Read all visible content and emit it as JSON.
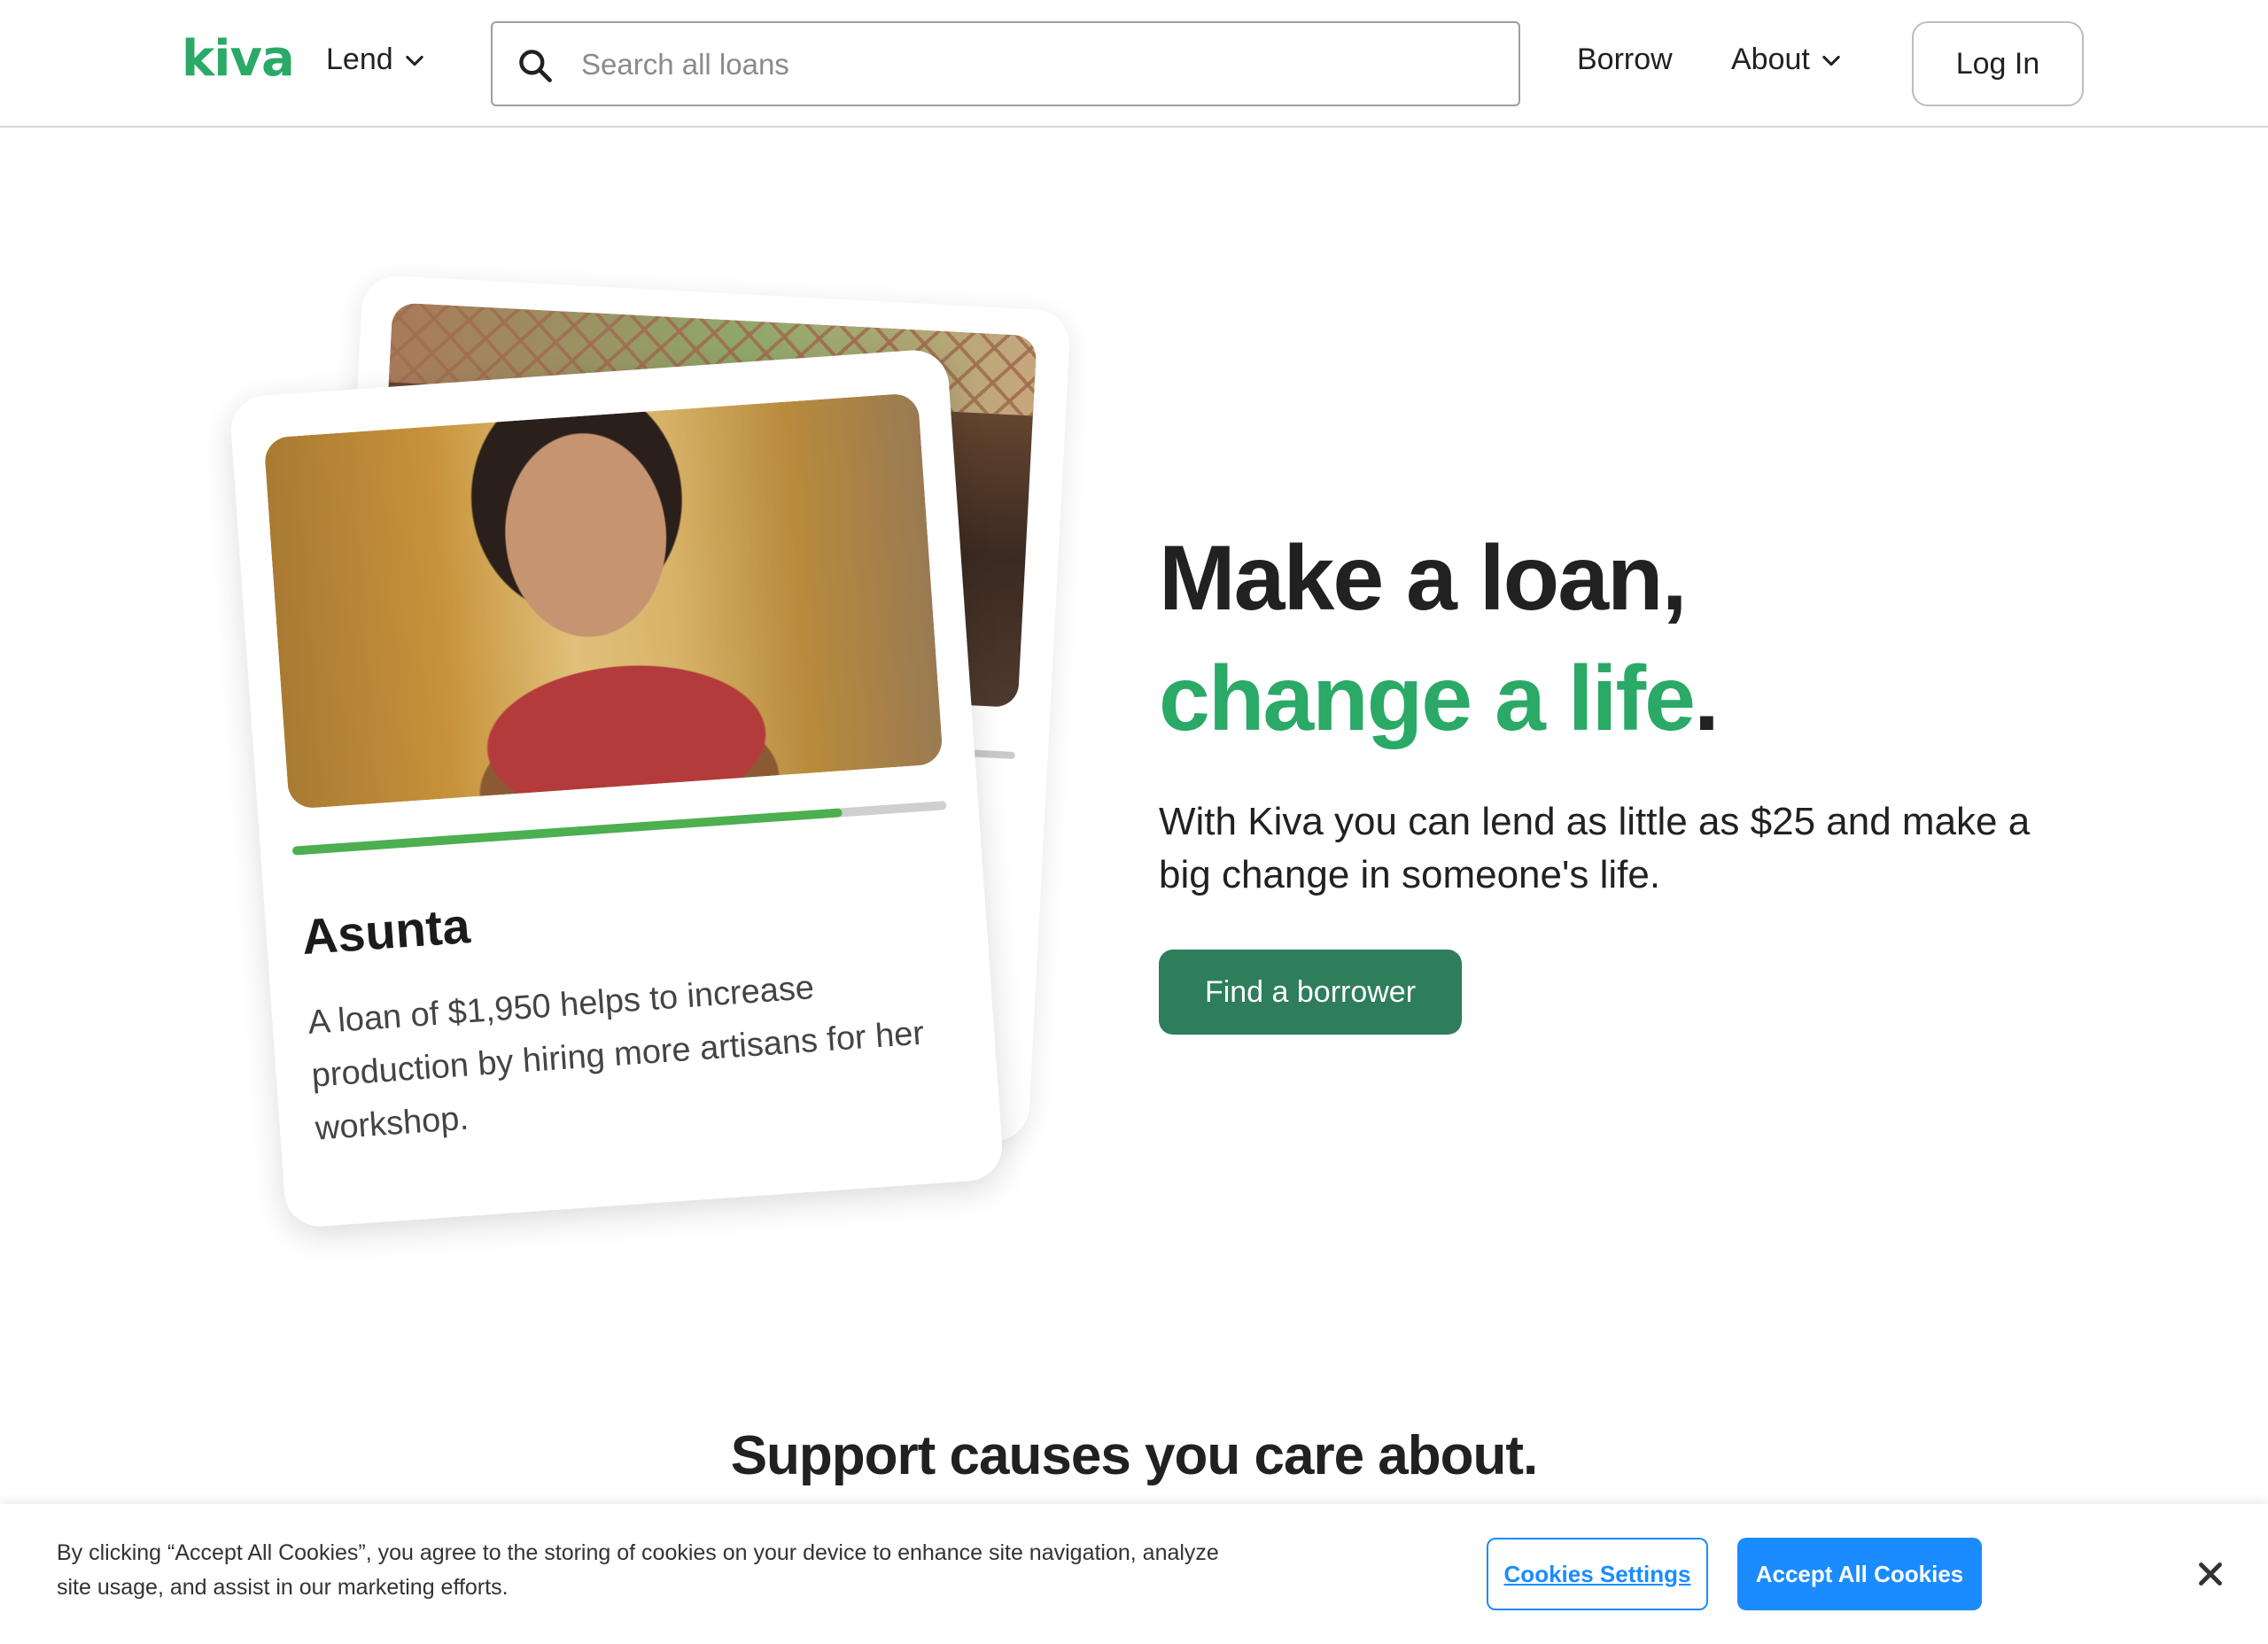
{
  "header": {
    "logo": "kiva",
    "nav_lend": "Lend",
    "search_placeholder": "Search all loans",
    "nav_borrow": "Borrow",
    "nav_about": "About",
    "login": "Log In"
  },
  "card": {
    "name": "Asunta",
    "description": "A loan of $1,950 helps to increase production by hiring more artisans for her workshop.",
    "funded_fraction": 0.84
  },
  "hero": {
    "title_line1": "Make a loan,",
    "title_line2_green": "change a life",
    "title_line2_end": ".",
    "subtitle": "With Kiva you can lend as little as $25 and make a big change in someone's life.",
    "cta": "Find a borrower"
  },
  "section": {
    "title": "Support causes you care about."
  },
  "cookie": {
    "text": "By clicking “Accept All Cookies”, you agree to the storing of cookies on your device to enhance site navigation, analyze site usage, and assist in our marketing efforts.",
    "settings": "Cookies Settings",
    "accept": "Accept All Cookies"
  },
  "colors": {
    "brand_green": "#2aa967",
    "cta_green": "#2e7d5b",
    "cookie_blue": "#1a8cff"
  }
}
